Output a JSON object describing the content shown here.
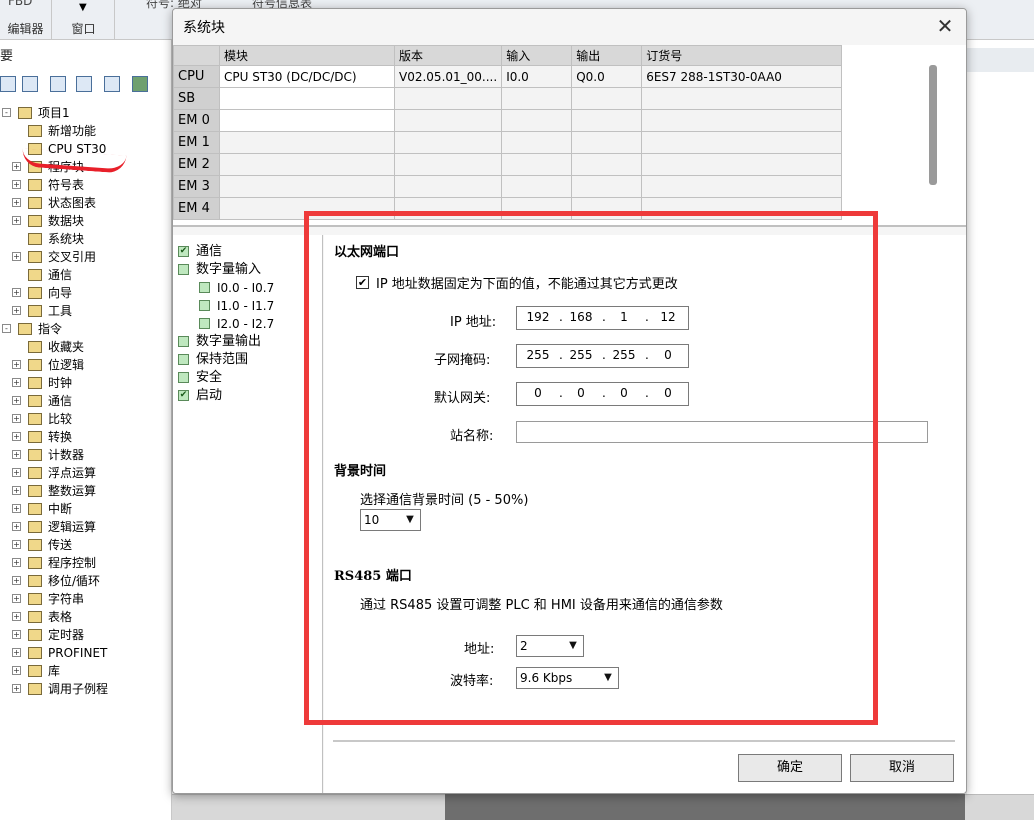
{
  "background_app": {
    "toolbar_group1_top": "FBD",
    "toolbar_group1_label": "编辑器",
    "toolbar_group2_label": "窗口",
    "toolbar_group3_top": "符号: 绝对",
    "toolbar_group4_top": "符号信息表",
    "left_panel_title": "要",
    "tree": [
      {
        "label": "项目1",
        "level": 0,
        "expand": "-"
      },
      {
        "label": "新增功能",
        "level": 1,
        "expand": ""
      },
      {
        "label": "CPU ST30",
        "level": 1,
        "expand": ""
      },
      {
        "label": "程序块",
        "level": 1,
        "expand": "+"
      },
      {
        "label": "符号表",
        "level": 1,
        "expand": "+"
      },
      {
        "label": "状态图表",
        "level": 1,
        "expand": "+"
      },
      {
        "label": "数据块",
        "level": 1,
        "expand": "+"
      },
      {
        "label": "系统块",
        "level": 1,
        "expand": ""
      },
      {
        "label": "交叉引用",
        "level": 1,
        "expand": "+"
      },
      {
        "label": "通信",
        "level": 1,
        "expand": ""
      },
      {
        "label": "向导",
        "level": 1,
        "expand": "+"
      },
      {
        "label": "工具",
        "level": 1,
        "expand": "+"
      },
      {
        "label": "指令",
        "level": 0,
        "expand": "-"
      },
      {
        "label": "收藏夹",
        "level": 1,
        "expand": ""
      },
      {
        "label": "位逻辑",
        "level": 1,
        "expand": "+"
      },
      {
        "label": "时钟",
        "level": 1,
        "expand": "+"
      },
      {
        "label": "通信",
        "level": 1,
        "expand": "+"
      },
      {
        "label": "比较",
        "level": 1,
        "expand": "+"
      },
      {
        "label": "转换",
        "level": 1,
        "expand": "+"
      },
      {
        "label": "计数器",
        "level": 1,
        "expand": "+"
      },
      {
        "label": "浮点运算",
        "level": 1,
        "expand": "+"
      },
      {
        "label": "整数运算",
        "level": 1,
        "expand": "+"
      },
      {
        "label": "中断",
        "level": 1,
        "expand": "+"
      },
      {
        "label": "逻辑运算",
        "level": 1,
        "expand": "+"
      },
      {
        "label": "传送",
        "level": 1,
        "expand": "+"
      },
      {
        "label": "程序控制",
        "level": 1,
        "expand": "+"
      },
      {
        "label": "移位/循环",
        "level": 1,
        "expand": "+"
      },
      {
        "label": "字符串",
        "level": 1,
        "expand": "+"
      },
      {
        "label": "表格",
        "level": 1,
        "expand": "+"
      },
      {
        "label": "定时器",
        "level": 1,
        "expand": "+"
      },
      {
        "label": "PROFINET",
        "level": 1,
        "expand": "+"
      },
      {
        "label": "库",
        "level": 1,
        "expand": "+"
      },
      {
        "label": "调用子例程",
        "level": 1,
        "expand": "+"
      }
    ]
  },
  "dialog": {
    "title": "系统块",
    "close_glyph": "✕",
    "table": {
      "headers": [
        "",
        "模块",
        "版本",
        "输入",
        "输出",
        "订货号"
      ],
      "rows": [
        {
          "slot": "CPU",
          "module": "CPU ST30 (DC/DC/DC)",
          "version": "V02.05.01_00....",
          "input": "I0.0",
          "output": "Q0.0",
          "order": "6ES7 288-1ST30-0AA0"
        },
        {
          "slot": "SB",
          "module": "",
          "version": "",
          "input": "",
          "output": "",
          "order": ""
        },
        {
          "slot": "EM 0",
          "module": "",
          "version": "",
          "input": "",
          "output": "",
          "order": ""
        },
        {
          "slot": "EM 1",
          "module": "",
          "version": "",
          "input": "",
          "output": "",
          "order": ""
        },
        {
          "slot": "EM 2",
          "module": "",
          "version": "",
          "input": "",
          "output": "",
          "order": ""
        },
        {
          "slot": "EM 3",
          "module": "",
          "version": "",
          "input": "",
          "output": "",
          "order": ""
        },
        {
          "slot": "EM 4",
          "module": "",
          "version": "",
          "input": "",
          "output": "",
          "order": ""
        }
      ]
    },
    "nav": [
      {
        "label": "通信",
        "sub": false
      },
      {
        "label": "数字量输入",
        "sub": false
      },
      {
        "label": "I0.0 - I0.7",
        "sub": true
      },
      {
        "label": "I1.0 - I1.7",
        "sub": true
      },
      {
        "label": "I2.0 - I2.7",
        "sub": true
      },
      {
        "label": "数字量输出",
        "sub": false
      },
      {
        "label": "保持范围",
        "sub": false
      },
      {
        "label": "安全",
        "sub": false
      },
      {
        "label": "启动",
        "sub": false
      }
    ],
    "ethernet": {
      "title": "以太网端口",
      "fixed_ip_label": "IP 地址数据固定为下面的值，不能通过其它方式更改",
      "fixed_ip_checked": true,
      "ip_label": "IP 地址:",
      "ip": [
        "192",
        "168",
        "1",
        "12"
      ],
      "mask_label": "子网掩码:",
      "mask": [
        "255",
        "255",
        "255",
        "0"
      ],
      "gateway_label": "默认网关:",
      "gateway": [
        "0",
        "0",
        "0",
        "0"
      ],
      "station_label": "站名称:",
      "station": ""
    },
    "background_time": {
      "title": "背景时间",
      "desc": "选择通信背景时间 (5 - 50%)",
      "value": "10"
    },
    "rs485": {
      "title": "RS485 端口",
      "desc": "通过 RS485 设置可调整 PLC 和 HMI 设备用来通信的通信参数",
      "address_label": "地址:",
      "address": "2",
      "baud_label": "波特率:",
      "baud": "9.6 Kbps"
    },
    "ok_label": "确定",
    "cancel_label": "取消"
  }
}
